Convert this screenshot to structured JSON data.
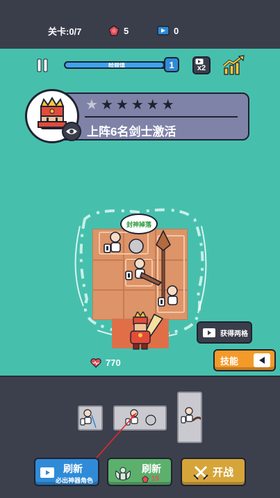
{
  "topbar": {
    "level_label": "关卡:0/7",
    "gems": "5",
    "tickets": "0"
  },
  "hud": {
    "xp_label": "经验值",
    "xp_progress": 0.95,
    "level": "1",
    "speed_label": "x2"
  },
  "mission": {
    "stars_total": 6,
    "stars_filled": 0,
    "text": "上阵6名剑士激活"
  },
  "board": {
    "speech": "封神掉落",
    "get_two_cells": "获得两格"
  },
  "skill": {
    "label": "技能"
  },
  "health": {
    "value": "770"
  },
  "buttons": {
    "refresh_ad_title": "刷新",
    "refresh_ad_sub": "必出神器角色",
    "refresh_cost_title": "刷新",
    "refresh_cost_value": "15",
    "start_label": "开战"
  },
  "colors": {
    "sea": "#46c0ad",
    "panel": "#3c404c",
    "accent_orange": "#f39a2a",
    "xp_blue": "#2f8bd8"
  }
}
